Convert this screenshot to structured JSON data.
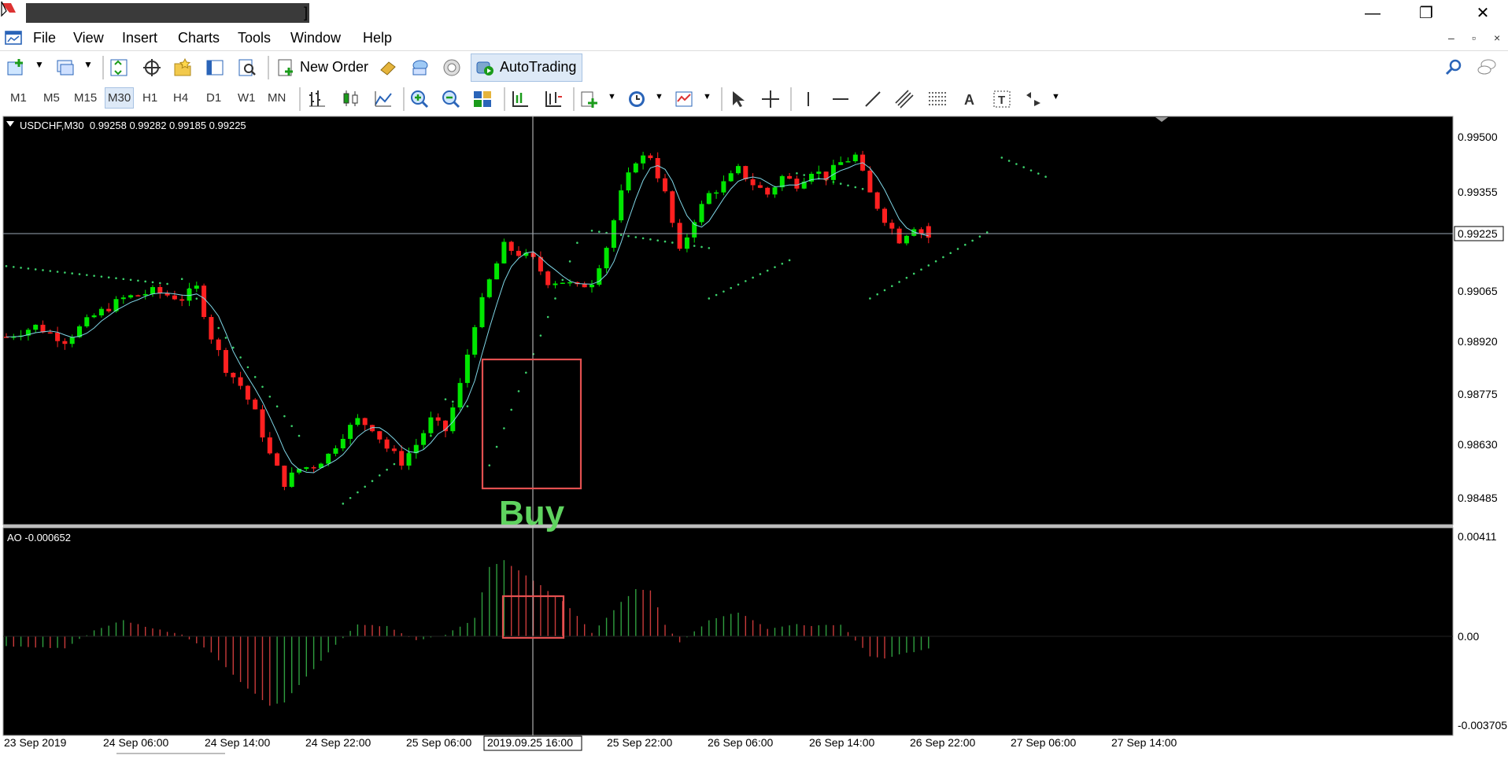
{
  "window": {
    "title_suffix": "]",
    "controls": [
      "—",
      "❐",
      "✕"
    ]
  },
  "menu": {
    "items": [
      "File",
      "View",
      "Insert",
      "Charts",
      "Tools",
      "Window",
      "Help"
    ],
    "mdi_controls": [
      "–",
      "▫",
      "×"
    ]
  },
  "toolbar": {
    "new_order": "New Order",
    "autotrading": "AutoTrading"
  },
  "timeframes": [
    "M1",
    "M5",
    "M15",
    "M30",
    "H1",
    "H4",
    "D1",
    "W1",
    "MN"
  ],
  "timeframe_selected": "M30",
  "chart": {
    "header": "USDCHF,M30  0.99258 0.99282 0.99185 0.99225",
    "current_price_label": "0.99225",
    "price_axis": [
      "0.99500",
      "0.99355",
      "0.99210",
      "0.99065",
      "0.98920",
      "0.98775",
      "0.98630",
      "0.98485"
    ],
    "annotation": "Buy",
    "annotation_color": "#5fd35f",
    "box_color": "#e35050",
    "bull_color": "#00e600",
    "bear_color": "#ff2020"
  },
  "indicator": {
    "header": "AO -0.000652",
    "axis": [
      "0.00411",
      "0.00",
      "-0.003705"
    ]
  },
  "time_axis": {
    "labels": [
      "23 Sep 2019",
      "24 Sep 06:00",
      "24 Sep 14:00",
      "24 Sep 22:00",
      "25 Sep 06:00",
      "25 Sep 22:00",
      "26 Sep 06:00",
      "26 Sep 14:00",
      "26 Sep 22:00",
      "27 Sep 06:00",
      "27 Sep 14:00"
    ],
    "crosshair_label": "2019.09.25 16:00"
  },
  "chart_data": {
    "type": "candlestick",
    "symbol": "USDCHF",
    "timeframe": "M30",
    "ohlc_last": {
      "open": 0.99258,
      "high": 0.99282,
      "low": 0.99185,
      "close": 0.99225
    },
    "price_range": [
      0.9842,
      0.9956
    ],
    "close_path": [
      [
        0,
        0.9894
      ],
      [
        4,
        0.9897
      ],
      [
        8,
        0.9893
      ],
      [
        12,
        0.99
      ],
      [
        16,
        0.9905
      ],
      [
        20,
        0.9907
      ],
      [
        24,
        0.9905
      ],
      [
        26,
        0.9908
      ],
      [
        28,
        0.9894
      ],
      [
        30,
        0.9885
      ],
      [
        32,
        0.988
      ],
      [
        34,
        0.9872
      ],
      [
        36,
        0.986
      ],
      [
        38,
        0.9852
      ],
      [
        40,
        0.9856
      ],
      [
        42,
        0.9857
      ],
      [
        44,
        0.986
      ],
      [
        46,
        0.9866
      ],
      [
        48,
        0.987
      ],
      [
        50,
        0.9868
      ],
      [
        52,
        0.9862
      ],
      [
        54,
        0.9858
      ],
      [
        56,
        0.9863
      ],
      [
        58,
        0.987
      ],
      [
        60,
        0.9867
      ],
      [
        62,
        0.988
      ],
      [
        64,
        0.9898
      ],
      [
        66,
        0.991
      ],
      [
        68,
        0.992
      ],
      [
        70,
        0.9918
      ],
      [
        72,
        0.9916
      ],
      [
        74,
        0.991
      ],
      [
        76,
        0.991
      ],
      [
        78,
        0.9908
      ],
      [
        80,
        0.991
      ],
      [
        82,
        0.992
      ],
      [
        84,
        0.9935
      ],
      [
        86,
        0.9945
      ],
      [
        88,
        0.9946
      ],
      [
        90,
        0.9935
      ],
      [
        92,
        0.9918
      ],
      [
        94,
        0.9928
      ],
      [
        96,
        0.9935
      ],
      [
        98,
        0.9938
      ],
      [
        100,
        0.9942
      ],
      [
        102,
        0.9938
      ],
      [
        104,
        0.9935
      ],
      [
        106,
        0.994
      ],
      [
        108,
        0.9938
      ],
      [
        110,
        0.9942
      ],
      [
        112,
        0.994
      ],
      [
        114,
        0.9944
      ],
      [
        116,
        0.9946
      ],
      [
        118,
        0.9935
      ],
      [
        120,
        0.9928
      ],
      [
        122,
        0.9922
      ],
      [
        124,
        0.9926
      ],
      [
        126,
        0.9922
      ]
    ],
    "ao_profile": [
      [
        0,
        -0.0005
      ],
      [
        8,
        -0.0006
      ],
      [
        12,
        0.0003
      ],
      [
        16,
        0.0008
      ],
      [
        20,
        0.0004
      ],
      [
        24,
        0.0001
      ],
      [
        28,
        -0.0008
      ],
      [
        32,
        -0.0023
      ],
      [
        36,
        -0.0035
      ],
      [
        38,
        -0.0033
      ],
      [
        44,
        -0.0008
      ],
      [
        48,
        0.0006
      ],
      [
        52,
        0.0005
      ],
      [
        56,
        -0.0002
      ],
      [
        60,
        0.0001
      ],
      [
        64,
        0.0009
      ],
      [
        66,
        0.0035
      ],
      [
        68,
        0.0038
      ],
      [
        72,
        0.0028
      ],
      [
        76,
        0.0018
      ],
      [
        80,
        0.0002
      ],
      [
        84,
        0.0017
      ],
      [
        86,
        0.0024
      ],
      [
        88,
        0.0023
      ],
      [
        90,
        0.0006
      ],
      [
        92,
        -0.0003
      ],
      [
        96,
        0.0008
      ],
      [
        100,
        0.0012
      ],
      [
        104,
        0.0004
      ],
      [
        108,
        0.0006
      ],
      [
        110,
        0.0005
      ],
      [
        114,
        0.0006
      ],
      [
        118,
        -0.001
      ],
      [
        120,
        -0.0011
      ],
      [
        126,
        -0.0006
      ]
    ],
    "sar_segments": [
      {
        "from": [
          0,
          0.99143
        ],
        "to": [
          22,
          0.99092
        ]
      },
      {
        "from": [
          24,
          0.99106
        ],
        "to": [
          40,
          0.98655
        ]
      },
      {
        "from": [
          46,
          0.9846
        ],
        "to": [
          58,
          0.98655
        ]
      },
      {
        "from": [
          60,
          0.9876
        ],
        "to": [
          63,
          0.9874
        ]
      },
      {
        "from": [
          66,
          0.9857
        ],
        "to": [
          78,
          0.9921
        ]
      },
      {
        "from": [
          80,
          0.99245
        ],
        "to": [
          96,
          0.99195
        ]
      },
      {
        "from": [
          96,
          0.9905
        ],
        "to": [
          107,
          0.9916
        ]
      },
      {
        "from": [
          108,
          0.9941
        ],
        "to": [
          118,
          0.9936
        ]
      },
      {
        "from": [
          118,
          0.9905
        ],
        "to": [
          134,
          0.9924
        ]
      },
      {
        "from": [
          136,
          0.99455
        ],
        "to": [
          142,
          0.994
        ]
      }
    ]
  }
}
